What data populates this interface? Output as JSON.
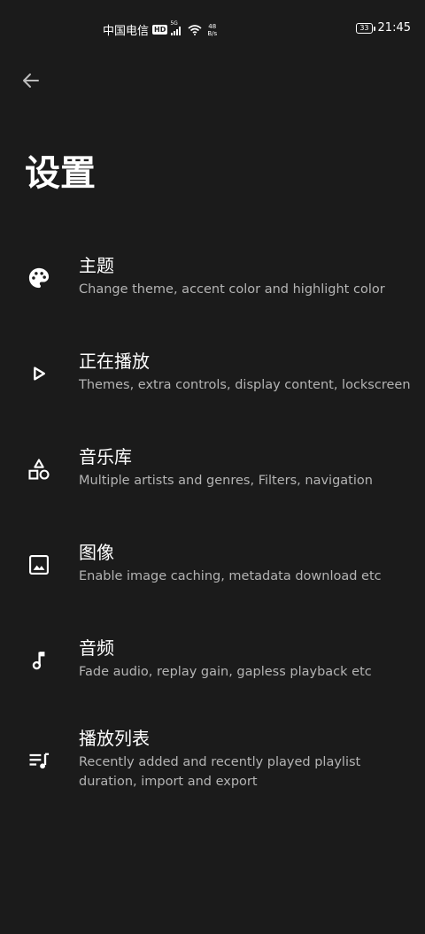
{
  "status_bar": {
    "carrier": "中国电信",
    "hd_badge": "HD",
    "network_type": "5G",
    "net_speed_value": "48",
    "net_speed_unit": "B/s",
    "battery_level": "33",
    "time": "21:45"
  },
  "header": {
    "back_icon": "arrow-back-icon",
    "title": "设置"
  },
  "settings": [
    {
      "icon": "palette-icon",
      "title": "主题",
      "description": "Change theme, accent color and highlight color"
    },
    {
      "icon": "play-icon",
      "title": "正在播放",
      "description": "Themes, extra controls, display content, lockscreen"
    },
    {
      "icon": "shapes-icon",
      "title": "音乐库",
      "description": "Multiple artists and genres, Filters, navigation"
    },
    {
      "icon": "image-icon",
      "title": "图像",
      "description": "Enable image caching, metadata download etc"
    },
    {
      "icon": "music-note-icon",
      "title": "音频",
      "description": "Fade audio, replay gain, gapless playback etc"
    },
    {
      "icon": "playlist-icon",
      "title": "播放列表",
      "description_line1": "Recently added and recently played playlist",
      "description_line2": "duration, import and export"
    }
  ]
}
